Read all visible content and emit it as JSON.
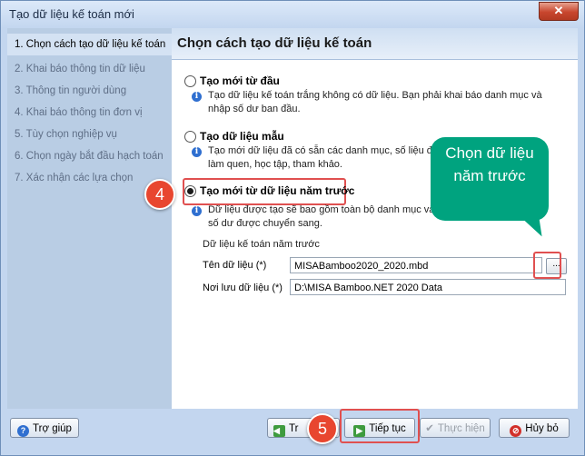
{
  "window": {
    "title": "Tạo dữ liệu kế toán mới",
    "close_label": "✕"
  },
  "sidebar": {
    "steps": [
      "1. Chọn cách tạo dữ liệu kế toán",
      "2. Khai báo thông tin dữ liệu",
      "3. Thông tin người dùng",
      "4. Khai báo thông tin đơn vị",
      "5. Tùy chọn nghiệp vụ",
      "6. Chọn ngày bắt đầu hạch toán",
      "7. Xác nhận các lựa chọn"
    ]
  },
  "main": {
    "heading": "Chọn cách tạo dữ liệu kế toán",
    "options": [
      {
        "label": "Tạo mới từ đầu",
        "desc": "Tạo dữ liệu kế toán trắng không có dữ liệu. Bạn phải khai báo danh mục và nhập số dư ban đầu.",
        "selected": false
      },
      {
        "label": "Tạo dữ liệu mẫu",
        "desc": "Tạo mới dữ liệu đã có sẵn các danh mục, số liệu để làm quen, học tập, tham khảo.",
        "selected": false
      },
      {
        "label": "Tạo mới từ dữ liệu năm trước",
        "desc": "Dữ liệu được tạo sẽ bao gồm toàn bộ danh mục và số dư được chuyển sang.",
        "selected": true
      }
    ],
    "group_label": "Dữ liệu kế toán năm trước",
    "data_name_label": "Tên dữ liệu (*)",
    "data_name_value": "MISABamboo2020_2020.mbd",
    "browse_label": "...",
    "location_label": "Nơi lưu dữ liệu (*)",
    "location_value": "D:\\MISA Bamboo.NET 2020 Data"
  },
  "annotations": {
    "callout_text": "Chọn dữ liệu năm trước",
    "badge_4": "4",
    "badge_5": "5"
  },
  "footer": {
    "help_label": "Trợ giúp",
    "back_label": "Trở lại",
    "back_visible": "Tr",
    "next_label": "Tiếp tục",
    "finish_label": "Thực hiện",
    "cancel_label": "Hủy bỏ"
  },
  "colors": {
    "callout": "#00a37f",
    "badge": "#e8462f",
    "highlight": "#e05050"
  }
}
